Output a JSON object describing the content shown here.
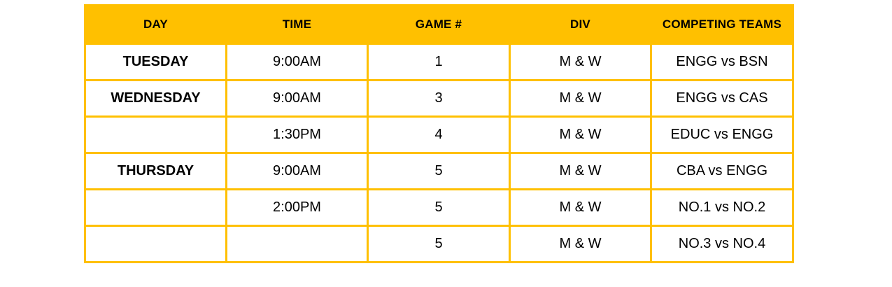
{
  "headers": {
    "day": "DAY",
    "time": "TIME",
    "game": "GAME #",
    "div": "DIV",
    "teams": "COMPETING TEAMS"
  },
  "rows": [
    {
      "day": "TUESDAY",
      "time": "9:00AM",
      "game": "1",
      "div": "M & W",
      "teams": "ENGG vs BSN"
    },
    {
      "day": "WEDNESDAY",
      "time": "9:00AM",
      "game": "3",
      "div": "M & W",
      "teams": "ENGG vs CAS"
    },
    {
      "day": "",
      "time": "1:30PM",
      "game": "4",
      "div": "M & W",
      "teams": "EDUC vs ENGG"
    },
    {
      "day": "THURSDAY",
      "time": "9:00AM",
      "game": "5",
      "div": "M & W",
      "teams": "CBA vs ENGG"
    },
    {
      "day": "",
      "time": "2:00PM",
      "game": "5",
      "div": "M & W",
      "teams": "NO.1 vs NO.2"
    },
    {
      "day": "",
      "time": "",
      "game": "5",
      "div": "M & W",
      "teams": "NO.3 vs NO.4"
    }
  ],
  "colors": {
    "accent": "#FFC000",
    "text": "#000000",
    "background": "#FFFFFF"
  }
}
